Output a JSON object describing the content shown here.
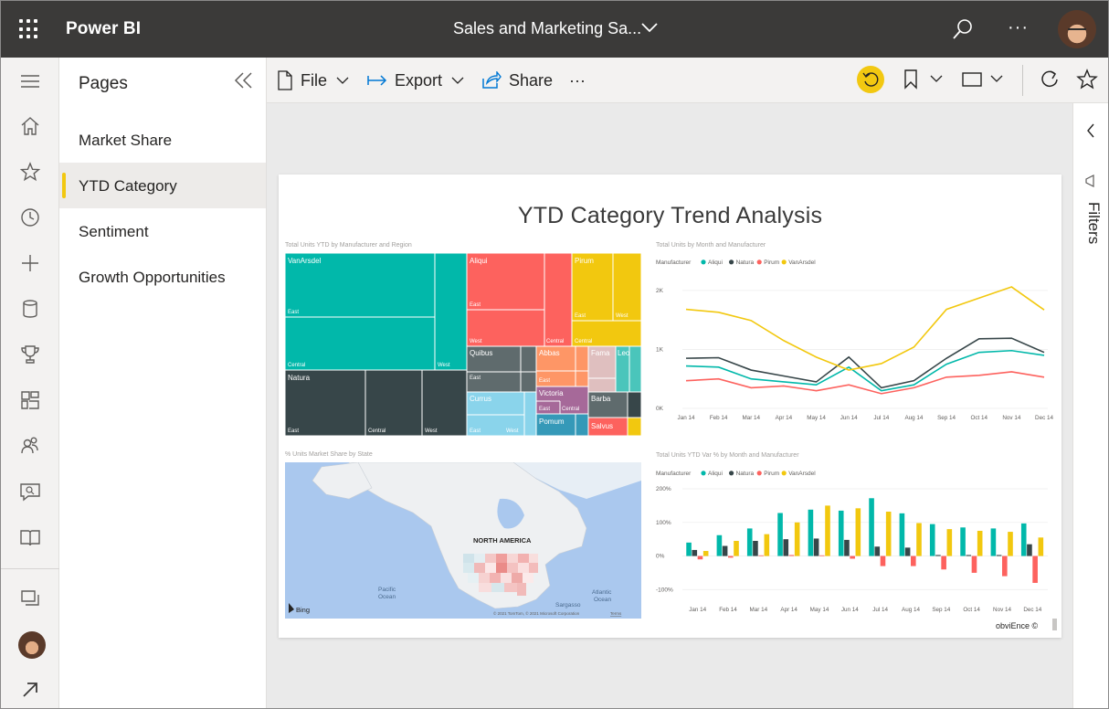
{
  "app": {
    "name": "Power BI",
    "report_title": "Sales and Marketing Sa..."
  },
  "topbar": {
    "more_label": "···"
  },
  "icons": {
    "waffle": "app-launcher-icon",
    "search": "search-icon",
    "more": "more-icon",
    "rail": [
      "menu-icon",
      "home-icon",
      "favorites-icon",
      "recent-icon",
      "create-icon",
      "datasets-icon",
      "goals-icon",
      "apps-icon",
      "shared-icon",
      "learn-icon",
      "workspaces-icon"
    ]
  },
  "pages_pane": {
    "title": "Pages",
    "items": [
      {
        "label": "Market Share",
        "active": false
      },
      {
        "label": "YTD Category",
        "active": true
      },
      {
        "label": "Sentiment",
        "active": false
      },
      {
        "label": "Growth Opportunities",
        "active": false
      }
    ]
  },
  "actionbar": {
    "file": "File",
    "export": "Export",
    "share": "Share",
    "more": "···"
  },
  "filters": {
    "label": "Filters"
  },
  "report": {
    "heading": "YTD Category Trend Analysis",
    "footer": "obviEnce ©"
  },
  "colors": {
    "aliqui": "#01b8aa",
    "natura": "#374649",
    "pirum": "#fd625e",
    "vanarsdel": "#f2c80f",
    "accent": "#f2c811",
    "topbar": "#3b3a39"
  },
  "treemap": {
    "title": "Total Units YTD by Manufacturer and Region",
    "labels": {
      "vanarsdel": "VanArsdel",
      "aliqui": "Aliqui",
      "pirum": "Pirum",
      "natura": "Natura",
      "quibus": "Quibus",
      "abbas": "Abbas",
      "fama": "Fama",
      "leo": "Leo",
      "currus": "Currus",
      "victoria": "Victoria",
      "barba": "Barba",
      "pomum": "Pomum",
      "salvus": "Salvus",
      "east": "East",
      "west": "West",
      "central": "Central"
    }
  },
  "map": {
    "title": "% Units Market Share by State",
    "continent": "NORTH AMERICA",
    "pacific": [
      "Pacific",
      "Ocean"
    ],
    "atlantic": [
      "Atlantic",
      "Ocean"
    ],
    "sargasso": "Sargasso",
    "bing": "Bing",
    "copyright": "© 2021 TomTom, © 2021 Microsoft Corporation",
    "terms": "Terms"
  },
  "chart_data": [
    {
      "type": "line",
      "title": "Total Units by Month and Manufacturer",
      "legend_title": "Manufacturer",
      "categories": [
        "Jan 14",
        "Feb 14",
        "Mar 14",
        "Apr 14",
        "May 14",
        "Jun 14",
        "Jul 14",
        "Aug 14",
        "Sep 14",
        "Oct 14",
        "Nov 14",
        "Dec 14"
      ],
      "y_ticks": [
        "0K",
        "1K",
        "2K"
      ],
      "ylim": [
        0,
        2200
      ],
      "series": [
        {
          "name": "Aliqui",
          "color": "#01b8aa",
          "values": [
            720,
            700,
            500,
            450,
            400,
            700,
            300,
            400,
            750,
            950,
            980,
            900
          ]
        },
        {
          "name": "Natura",
          "color": "#374649",
          "values": [
            850,
            860,
            650,
            550,
            450,
            870,
            350,
            470,
            850,
            1180,
            1190,
            950
          ]
        },
        {
          "name": "Pirum",
          "color": "#fd625e",
          "values": [
            470,
            500,
            350,
            380,
            300,
            400,
            250,
            350,
            530,
            560,
            620,
            530
          ]
        },
        {
          "name": "VanArsdel",
          "color": "#f2c80f",
          "values": [
            1680,
            1630,
            1490,
            1150,
            870,
            650,
            760,
            1040,
            1680,
            1870,
            2060,
            1670
          ]
        }
      ],
      "legend": "top-left",
      "grid": true
    },
    {
      "type": "bar",
      "title": "Total Units YTD Var % by Month and Manufacturer",
      "legend_title": "Manufacturer",
      "categories": [
        "Jan 14",
        "Feb 14",
        "Mar 14",
        "Apr 14",
        "May 14",
        "Jun 14",
        "Jul 14",
        "Aug 14",
        "Sep 14",
        "Oct 14",
        "Nov 14",
        "Dec 14"
      ],
      "y_ticks": [
        "-100%",
        "0%",
        "100%",
        "200%"
      ],
      "ylim": [
        -110,
        200
      ],
      "series": [
        {
          "name": "Aliqui",
          "color": "#01b8aa",
          "values": [
            40,
            62,
            82,
            128,
            138,
            135,
            172,
            127,
            95,
            85,
            82,
            97
          ]
        },
        {
          "name": "Natura",
          "color": "#374649",
          "values": [
            18,
            30,
            45,
            50,
            52,
            48,
            28,
            25,
            3,
            3,
            3,
            35
          ]
        },
        {
          "name": "Pirum",
          "color": "#fd625e",
          "values": [
            -10,
            -5,
            2,
            3,
            2,
            -8,
            -30,
            -30,
            -40,
            -50,
            -60,
            -80
          ]
        },
        {
          "name": "VanArsdel",
          "color": "#f2c80f",
          "values": [
            15,
            45,
            65,
            100,
            150,
            142,
            132,
            98,
            80,
            75,
            72,
            55
          ]
        }
      ],
      "legend": "top-left",
      "grid": true
    }
  ]
}
